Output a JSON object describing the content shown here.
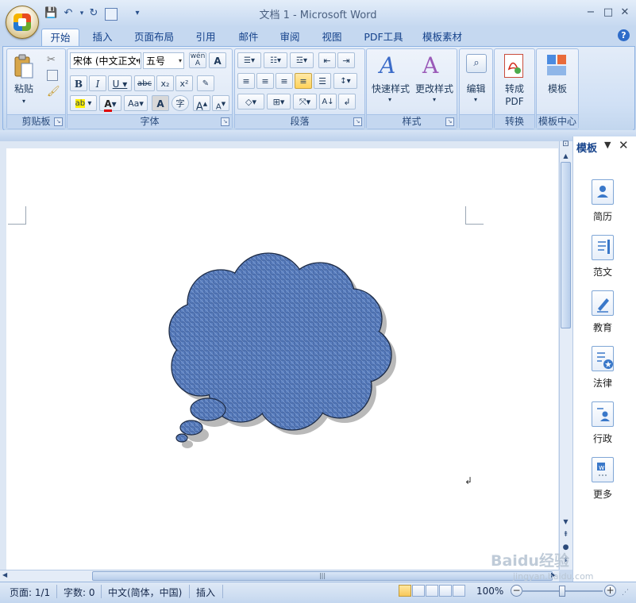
{
  "window": {
    "title": "文档 1 - Microsoft Word",
    "controls": {
      "minimize": "−",
      "maximize": "□",
      "close": "✕"
    }
  },
  "quick_access": {
    "save": "💾",
    "undo": "↶",
    "redo": "↻",
    "more": "▾"
  },
  "tabs": [
    {
      "label": "开始",
      "active": true
    },
    {
      "label": "插入"
    },
    {
      "label": "页面布局"
    },
    {
      "label": "引用"
    },
    {
      "label": "邮件"
    },
    {
      "label": "审阅"
    },
    {
      "label": "视图"
    },
    {
      "label": "PDF工具"
    },
    {
      "label": "模板素材"
    }
  ],
  "ribbon": {
    "clipboard": {
      "label": "剪贴板",
      "paste": "粘贴"
    },
    "font": {
      "label": "字体",
      "font_name": "宋体 (中文正文)",
      "font_size": "五号",
      "buttons": {
        "bold": "B",
        "italic": "I",
        "underline": "U",
        "strike": "abc",
        "sub": "x₂",
        "sup": "x²",
        "aa": "Aa",
        "char_border": "A",
        "enclose": "字",
        "grow": "A",
        "shrink": "A"
      }
    },
    "paragraph": {
      "label": "段落"
    },
    "styles": {
      "label": "样式",
      "quick_styles": "快速样式",
      "change_styles": "更改样式"
    },
    "editing": {
      "label": "",
      "edit": "编辑"
    },
    "convert": {
      "label": "转换",
      "to_pdf_line1": "转成",
      "to_pdf_line2": "PDF"
    },
    "template_center": {
      "label": "模板中心",
      "template": "模板"
    }
  },
  "side_panel": {
    "title": "模板",
    "items": [
      {
        "label": "简历",
        "icon": "resume-icon"
      },
      {
        "label": "范文",
        "icon": "sample-essay-icon"
      },
      {
        "label": "教育",
        "icon": "education-icon"
      },
      {
        "label": "法律",
        "icon": "law-icon"
      },
      {
        "label": "行政",
        "icon": "admin-icon"
      },
      {
        "label": "更多",
        "icon": "more-icon"
      }
    ]
  },
  "status_bar": {
    "page": "页面: 1/1",
    "words": "字数: 0",
    "language": "中文(简体，中国)",
    "mode": "插入",
    "zoom": "100%",
    "zoom_level": 1.0
  },
  "document": {
    "shape": "thought-bubble-cloud",
    "fill_color": "#5b7fbf"
  },
  "watermark": {
    "text": "Baidu经验",
    "url": "jingyan.baidu.com"
  }
}
